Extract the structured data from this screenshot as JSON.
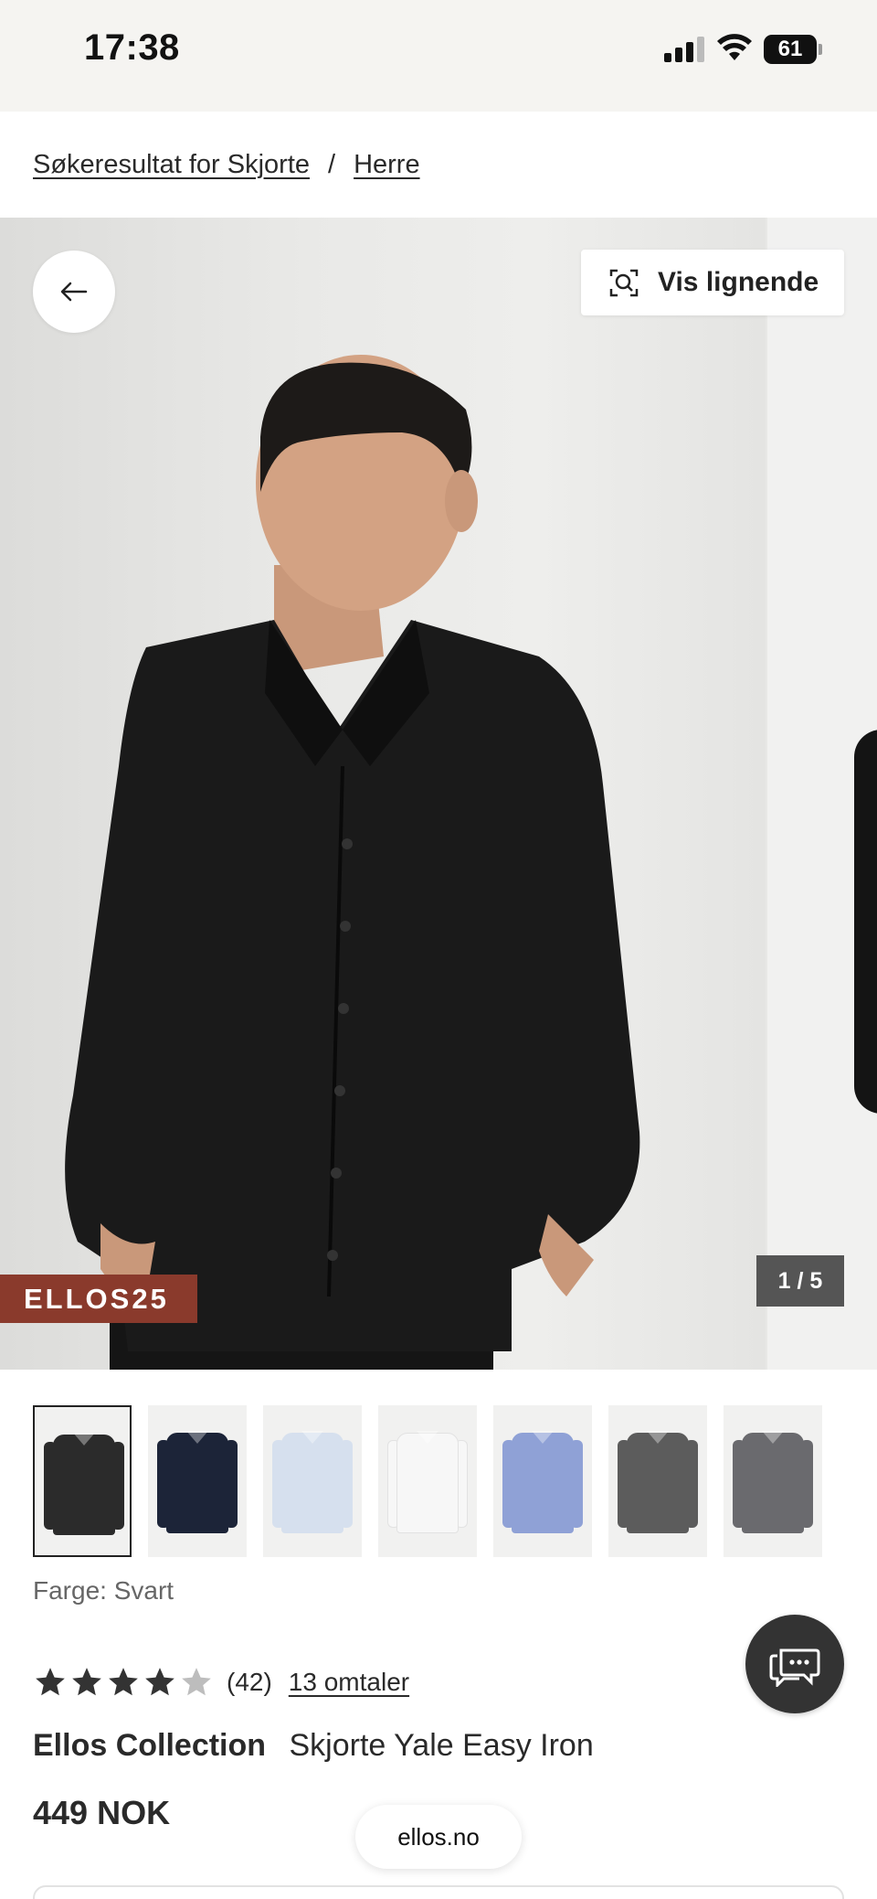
{
  "status_bar": {
    "time": "17:38",
    "battery": "61",
    "icons": [
      "signal-icon",
      "wifi-icon",
      "battery-icon"
    ]
  },
  "breadcrumb": {
    "items": [
      "Søkeresultat for Skjorte",
      "Herre"
    ],
    "separator": "/"
  },
  "gallery": {
    "back_icon": "arrow-left-icon",
    "similar_label": "Vis lignende",
    "similar_icon": "visual-search-icon",
    "promo_code": "ELLOS25",
    "counter": "1 / 5",
    "promo_color": "#8a3a2c"
  },
  "thumbnails": [
    {
      "color": "#2b2b2b",
      "selected": true
    },
    {
      "color": "#1c2438",
      "selected": false
    },
    {
      "color": "#d6e0ee",
      "selected": false
    },
    {
      "color": "#f7f7f7",
      "selected": false
    },
    {
      "color": "#8fa1d6",
      "selected": false
    },
    {
      "color": "#5c5c5c",
      "selected": false
    },
    {
      "color": "#6a6a6e",
      "selected": false
    }
  ],
  "product": {
    "color_label": "Farge: Svart",
    "rating": 4,
    "rating_max": 5,
    "rating_count": "(42)",
    "reviews_link": "13 omtaler",
    "brand": "Ellos Collection",
    "name": "Skjorte Yale Easy Iron",
    "price": "449 NOK"
  },
  "chat": {
    "icon": "chat-bubbles-icon"
  },
  "browser": {
    "url": "ellos.no"
  }
}
